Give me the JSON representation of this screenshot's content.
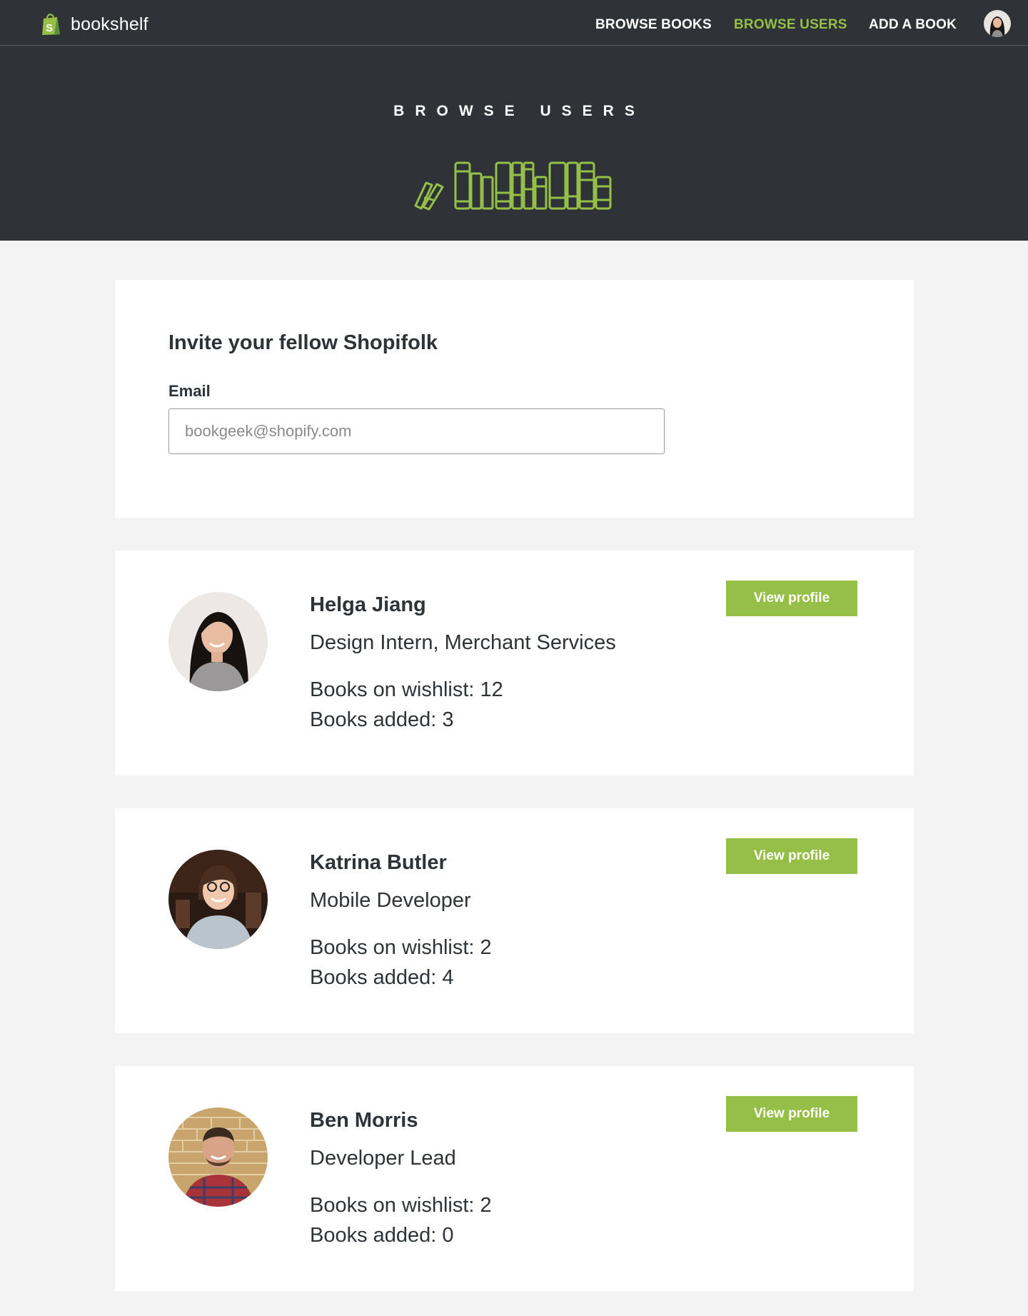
{
  "header": {
    "brand_name": "bookshelf",
    "logo_icon": "shopify-bag-icon",
    "nav": [
      {
        "label": "BROWSE BOOKS",
        "active": false
      },
      {
        "label": "BROWSE USERS",
        "active": true
      },
      {
        "label": "ADD A BOOK",
        "active": false
      }
    ],
    "avatar_icon": "user-avatar"
  },
  "hero": {
    "title": "BROWSE USERS",
    "art_icon": "bookshelf-illustration-icon"
  },
  "invite": {
    "title": "Invite your fellow Shopifolk",
    "email_label": "Email",
    "email_placeholder": "bookgeek@shopify.com",
    "email_value": ""
  },
  "users": [
    {
      "name": "Helga Jiang",
      "role": "Design Intern, Merchant Services",
      "wishlist": "Books on wishlist: 12",
      "added": "Books added: 3",
      "button": "View profile"
    },
    {
      "name": "Katrina Butler",
      "role": "Mobile Developer",
      "wishlist": "Books on wishlist: 2",
      "added": "Books added: 4",
      "button": "View profile"
    },
    {
      "name": "Ben Morris",
      "role": "Developer Lead",
      "wishlist": "Books on wishlist: 2",
      "added": "Books added: 0",
      "button": "View profile"
    }
  ],
  "colors": {
    "header_bg": "#2e3338",
    "accent": "#96bf48",
    "page_bg": "#f3f3f3",
    "card_bg": "#ffffff"
  }
}
